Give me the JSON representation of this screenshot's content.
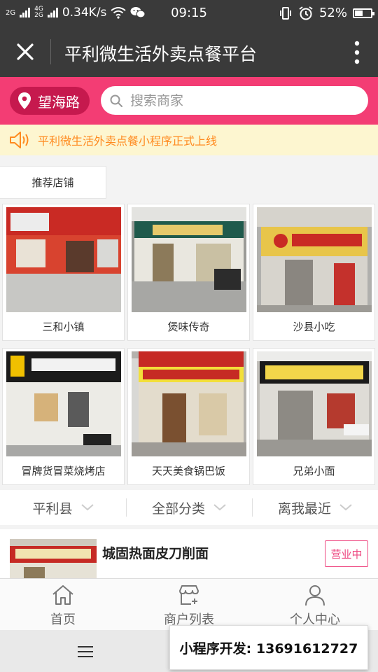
{
  "status_bar": {
    "net_tag_top": "4G",
    "net_tag_bottom": "2G",
    "net_prefix": "2G",
    "speed": "0.34K/s",
    "time": "09:15",
    "battery": "52%",
    "battery_level": 0.52
  },
  "nav": {
    "title": "平利微生活外卖点餐平台"
  },
  "search": {
    "location": "望海路",
    "placeholder": "搜索商家"
  },
  "notice": {
    "text": "平利微生活外卖点餐小程序正式上线",
    "color": "#ff8a1f"
  },
  "recommend": {
    "tab_label": "推荐店铺",
    "shops": [
      {
        "name": "三和小镇"
      },
      {
        "name": "煲味传奇"
      },
      {
        "name": "沙县小吃"
      },
      {
        "name": "冒牌货冒菜烧烤店"
      },
      {
        "name": "天天美食锅巴饭"
      },
      {
        "name": "兄弟小面"
      }
    ]
  },
  "filters": [
    {
      "label": "平利县"
    },
    {
      "label": "全部分类"
    },
    {
      "label": "离我最近"
    }
  ],
  "shop_list": [
    {
      "name": "城固热面皮刀削面",
      "status": "营业中"
    }
  ],
  "tabbar": [
    {
      "label": "首页",
      "icon": "home-icon"
    },
    {
      "label": "商户列表",
      "icon": "store-icon"
    },
    {
      "label": "个人中心",
      "icon": "user-icon"
    }
  ],
  "promo": {
    "text": "小程序开发: 13691612727"
  },
  "colors": {
    "accent": "#f33d74",
    "location_pill": "#c6194e",
    "badge": "#ee4780",
    "header": "#3a3a3a"
  }
}
